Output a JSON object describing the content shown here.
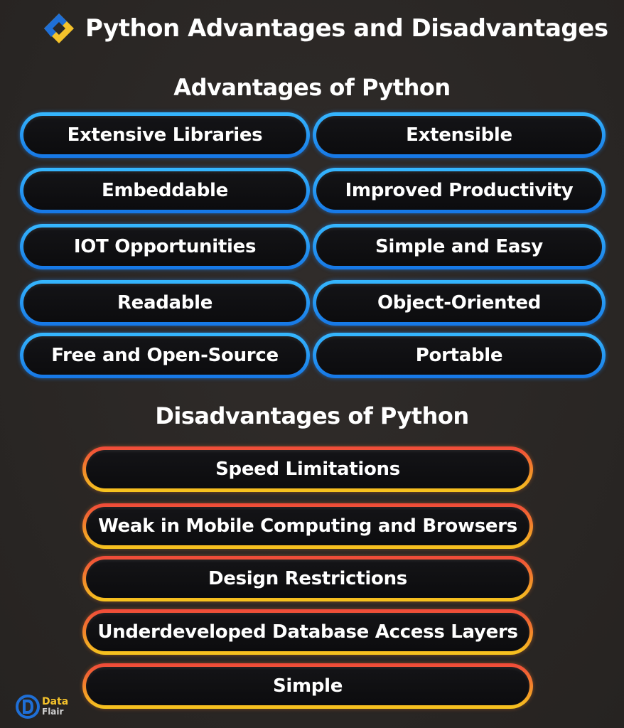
{
  "header": {
    "title": "Python Advantages and Disadvantages"
  },
  "advantages": {
    "title": "Advantages of Python",
    "left": [
      "Extensive Libraries",
      "Embeddable",
      "IOT Opportunities",
      "Readable",
      "Free and Open-Source"
    ],
    "right": [
      "Extensible",
      "Improved Productivity",
      "Simple and Easy",
      "Object-Oriented",
      "Portable"
    ]
  },
  "disadvantages": {
    "title": "Disadvantages of Python",
    "items": [
      "Speed Limitations",
      "Weak in Mobile Computing and Browsers",
      "Design Restrictions",
      "Underdeveloped Database Access Layers",
      "Simple"
    ]
  },
  "footer": {
    "brand_line1": "Data",
    "brand_line2": "Flair"
  },
  "colors": {
    "background": "#2b2826",
    "advantage_border": "#1e90ff",
    "disadvantage_border": "#f28b2a",
    "logo_gold": "#f4c22b",
    "logo_blue": "#1f6fd6"
  }
}
